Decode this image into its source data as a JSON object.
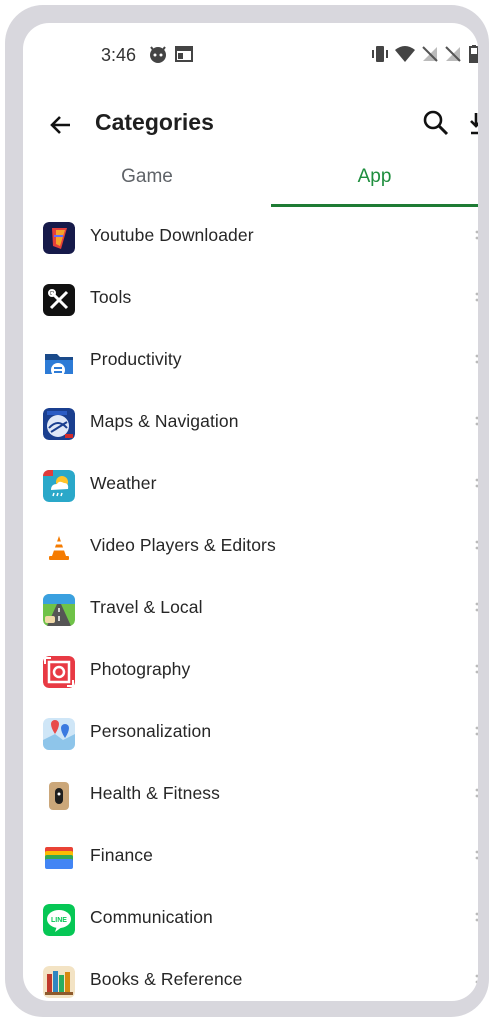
{
  "status_bar": {
    "time": "3:46"
  },
  "header": {
    "title": "Categories"
  },
  "tabs": [
    {
      "label": "Game",
      "selected": false
    },
    {
      "label": "App",
      "selected": true
    }
  ],
  "accent_color": "#1e8e3e",
  "categories": [
    {
      "label": "Youtube Downloader",
      "icon": "youtube-downloader-icon"
    },
    {
      "label": "Tools",
      "icon": "tools-icon"
    },
    {
      "label": "Productivity",
      "icon": "file-explorer-icon"
    },
    {
      "label": "Maps & Navigation",
      "icon": "europe-map-icon"
    },
    {
      "label": "Weather",
      "icon": "weather-icon"
    },
    {
      "label": "Video Players & Editors",
      "icon": "vlc-cone-icon"
    },
    {
      "label": "Travel & Local",
      "icon": "road-icon"
    },
    {
      "label": "Photography",
      "icon": "camera-frame-icon"
    },
    {
      "label": "Personalization",
      "icon": "map-pins-icon"
    },
    {
      "label": "Health & Fitness",
      "icon": "fitness-band-icon"
    },
    {
      "label": "Finance",
      "icon": "wallet-icon"
    },
    {
      "label": "Communication",
      "icon": "line-chat-icon"
    },
    {
      "label": "Books & Reference",
      "icon": "bookshelf-icon"
    }
  ]
}
